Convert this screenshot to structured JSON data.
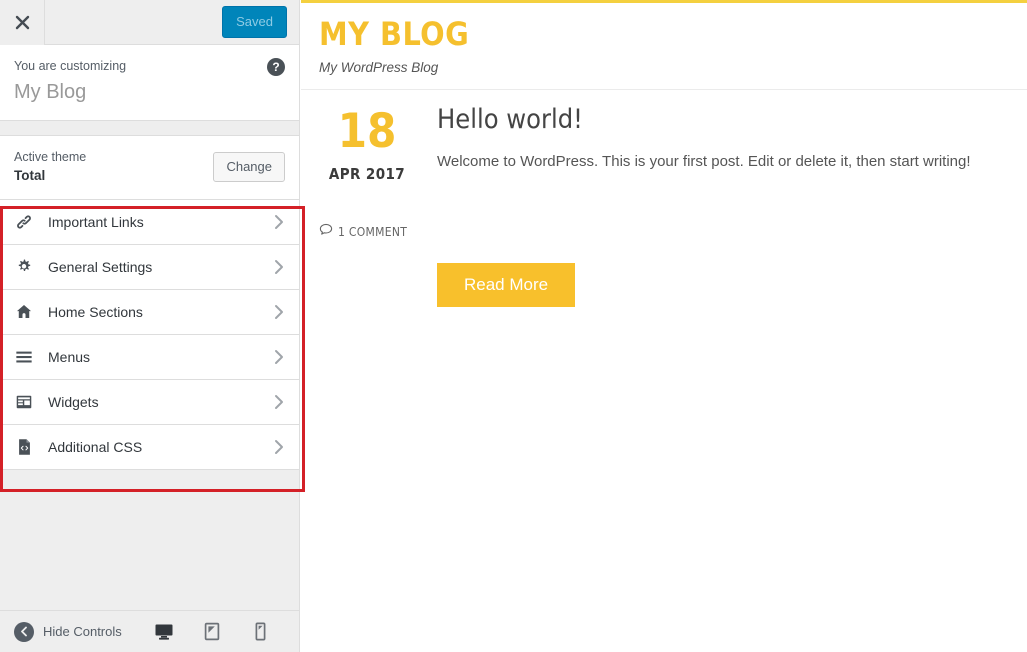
{
  "customizer": {
    "close_label": "Close customizer",
    "save_button": "Saved",
    "customizing_label": "You are customizing",
    "site_name": "My Blog",
    "help_glyph": "?",
    "theme": {
      "label": "Active theme",
      "name": "Total",
      "change_button": "Change"
    },
    "sections": [
      {
        "label": "Important Links",
        "icon": "link-icon"
      },
      {
        "label": "General Settings",
        "icon": "gear-icon"
      },
      {
        "label": "Home Sections",
        "icon": "home-icon"
      },
      {
        "label": "Menus",
        "icon": "menu-icon"
      },
      {
        "label": "Widgets",
        "icon": "widgets-icon"
      },
      {
        "label": "Additional CSS",
        "icon": "code-file-icon"
      }
    ],
    "footer": {
      "hide_controls": "Hide Controls",
      "devices": [
        {
          "name": "desktop",
          "active": true
        },
        {
          "name": "tablet",
          "active": false
        },
        {
          "name": "mobile",
          "active": false
        }
      ]
    }
  },
  "preview": {
    "site_title": "MY BLOG",
    "site_description": "My WordPress Blog",
    "post": {
      "day": "18",
      "month_year": "APR 2017",
      "title": "Hello world!",
      "excerpt": "Welcome to WordPress. This is your first post. Edit or delete it, then start writing!",
      "comments": "1 COMMENT",
      "read_more": "Read More"
    }
  },
  "colors": {
    "accent_yellow": "#f8c02c",
    "title_yellow": "#f5c02e",
    "save_blue": "#0085ba",
    "annotation_red": "#d42027",
    "panel_gray": "#eeeeee"
  }
}
